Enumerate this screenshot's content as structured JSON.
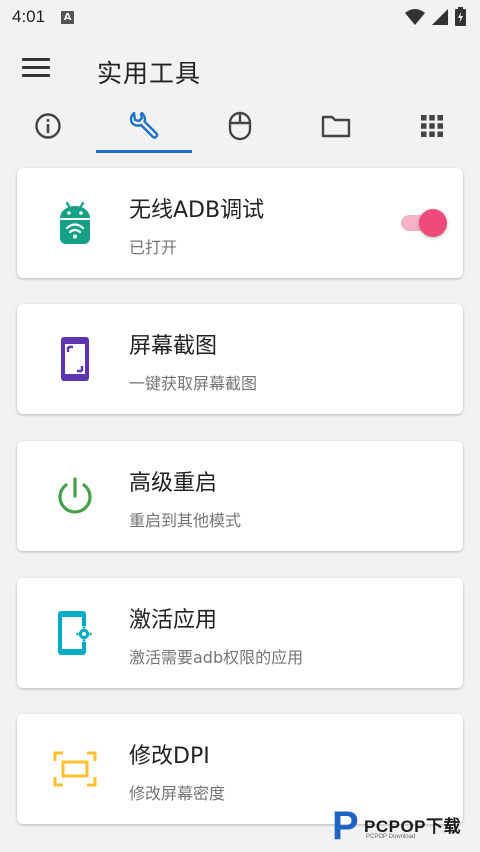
{
  "status_bar": {
    "time": "4:01",
    "notification_icon": "a-notification-icon"
  },
  "app_bar": {
    "title": "实用工具"
  },
  "tabs": [
    {
      "icon": "info-icon",
      "selected": false
    },
    {
      "icon": "wrench-icon",
      "selected": true
    },
    {
      "icon": "mouse-icon",
      "selected": false
    },
    {
      "icon": "folder-icon",
      "selected": false
    },
    {
      "icon": "apps-grid-icon",
      "selected": false
    }
  ],
  "cards": [
    {
      "title": "无线ADB调试",
      "subtitle": "已打开",
      "icon": "android-wifi-icon",
      "toggle_on": true
    },
    {
      "title": "屏幕截图",
      "subtitle": "一键获取屏幕截图",
      "icon": "screenshot-icon"
    },
    {
      "title": "高级重启",
      "subtitle": "重启到其他模式",
      "icon": "power-icon"
    },
    {
      "title": "激活应用",
      "subtitle": "激活需要adb权限的应用",
      "icon": "phone-settings-icon"
    },
    {
      "title": "修改DPI",
      "subtitle": "修改屏幕密度",
      "icon": "screen-dpi-icon"
    }
  ],
  "watermark": {
    "logo_letter": "P",
    "text": "PCPOP下载",
    "subtext": "PCPOP Download"
  },
  "colors": {
    "accent": "#1e73c8",
    "toggle_thumb": "#ee4a7a",
    "toggle_track": "#f7b3c6",
    "android_green": "#16a085",
    "screenshot_purple": "#5e35b1",
    "power_green": "#43a047",
    "activate_cyan": "#00acc1",
    "dpi_yellow": "#fbc02d"
  }
}
